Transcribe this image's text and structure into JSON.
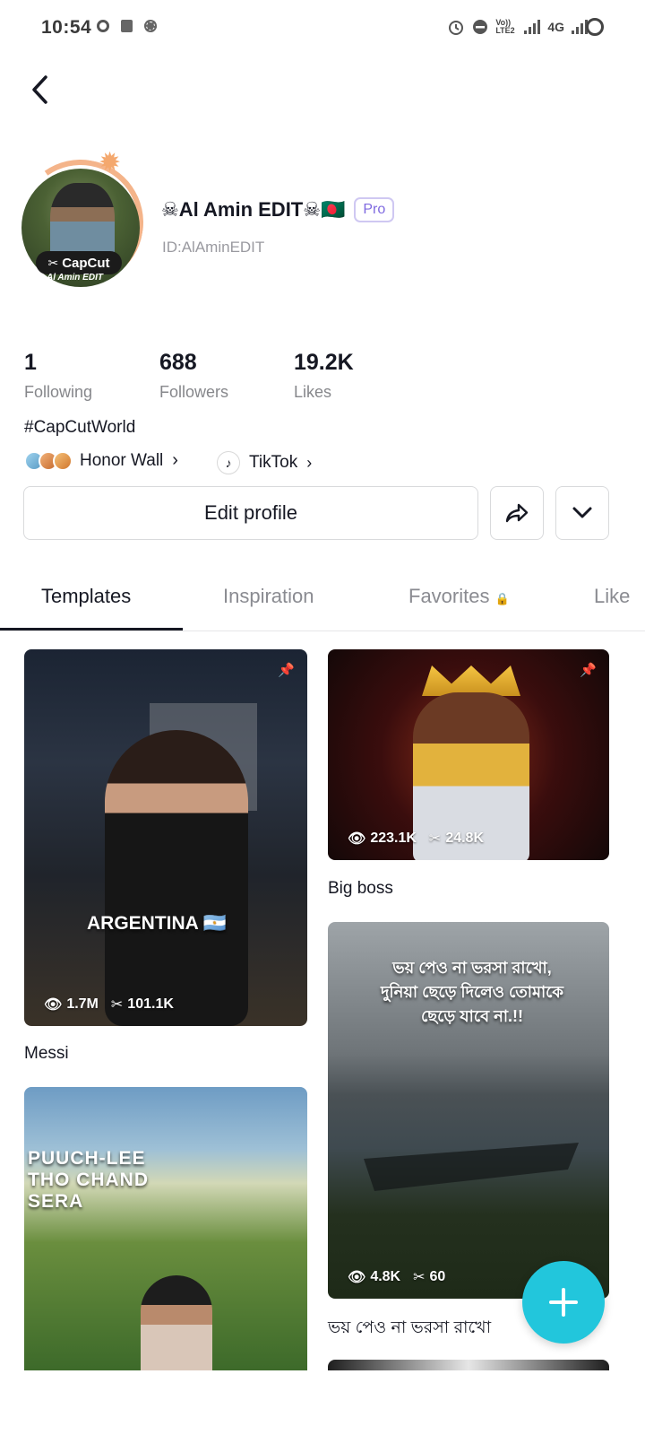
{
  "status_bar": {
    "time": "10:54",
    "network_label": "4G",
    "volte_label": "Vo)) LTE2"
  },
  "profile": {
    "display_name": "☠Al Amin EDIT☠🇧🇩",
    "pro_badge": "Pro",
    "user_id": "ID:AlAminEDIT",
    "avatar_badge": "CapCut",
    "avatar_sub": "Al Amin EDIT",
    "bio": "#CapCutWorld"
  },
  "stats": [
    {
      "value": "1",
      "label": "Following"
    },
    {
      "value": "688",
      "label": "Followers"
    },
    {
      "value": "19.2K",
      "label": "Likes"
    }
  ],
  "honor_wall": {
    "label": "Honor Wall"
  },
  "tiktok": {
    "label": "TikTok"
  },
  "actions": {
    "edit_profile": "Edit profile"
  },
  "tabs": [
    {
      "label": "Templates",
      "active": true
    },
    {
      "label": "Inspiration",
      "active": false
    },
    {
      "label": "Favorites",
      "active": false
    },
    {
      "label": "Like",
      "active": false
    }
  ],
  "templates": [
    {
      "title": "Messi",
      "views": "1.7M",
      "uses": "101.1K",
      "pinned": true,
      "overlay": "ARGENTINA 🇦🇷"
    },
    {
      "title": "Big boss",
      "views": "223.1K",
      "uses": "24.8K",
      "pinned": true,
      "overlay": ""
    },
    {
      "title": "ভয় পেও না ভরসা রাখো",
      "views": "4.8K",
      "uses": "60",
      "pinned": false,
      "overlay": "ভয় পেও না ভরসা রাখো,\nদুনিয়া ছেড়ে দিলেও তোমাকে\nছেড়ে যাবে না.!!"
    },
    {
      "title": "",
      "views": "",
      "uses": "",
      "pinned": false,
      "overlay": "PUUCH-LEE\nTHO CHAND\nSERA"
    }
  ],
  "colors": {
    "accent": "#22c6dc",
    "pro": "#7f6ae0",
    "text_primary": "#161823",
    "text_secondary": "#86878b"
  }
}
